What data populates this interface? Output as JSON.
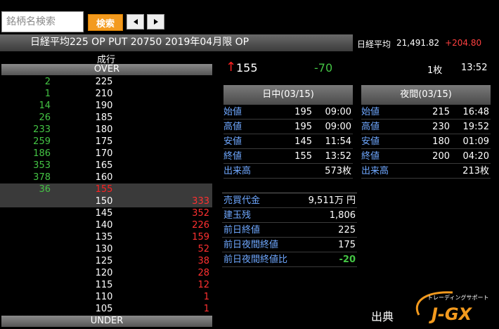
{
  "search": {
    "placeholder": "銘柄名検索",
    "button_label": "検索"
  },
  "title": "日経平均225 OP PUT 20750 2019年04月限 OP",
  "index": {
    "name": "日経平均",
    "value": "21,491.82",
    "change": "+204.80"
  },
  "board": {
    "header": "成行",
    "over_label": "OVER",
    "under_label": "UNDER",
    "rows": [
      {
        "bid": "2",
        "price": "225",
        "ask": ""
      },
      {
        "bid": "1",
        "price": "210",
        "ask": ""
      },
      {
        "bid": "14",
        "price": "190",
        "ask": ""
      },
      {
        "bid": "26",
        "price": "185",
        "ask": ""
      },
      {
        "bid": "233",
        "price": "180",
        "ask": ""
      },
      {
        "bid": "259",
        "price": "175",
        "ask": ""
      },
      {
        "bid": "186",
        "price": "170",
        "ask": ""
      },
      {
        "bid": "353",
        "price": "165",
        "ask": ""
      },
      {
        "bid": "378",
        "price": "160",
        "ask": ""
      },
      {
        "bid": "36",
        "price": "155",
        "ask": ""
      },
      {
        "bid": "",
        "price": "150",
        "ask": "333"
      },
      {
        "bid": "",
        "price": "145",
        "ask": "352"
      },
      {
        "bid": "",
        "price": "140",
        "ask": "226"
      },
      {
        "bid": "",
        "price": "135",
        "ask": "159"
      },
      {
        "bid": "",
        "price": "130",
        "ask": "52"
      },
      {
        "bid": "",
        "price": "125",
        "ask": "38"
      },
      {
        "bid": "",
        "price": "120",
        "ask": "28"
      },
      {
        "bid": "",
        "price": "115",
        "ask": "12"
      },
      {
        "bid": "",
        "price": "110",
        "ask": "1"
      },
      {
        "bid": "",
        "price": "105",
        "ask": "1"
      }
    ]
  },
  "quote": {
    "arrow": "↑",
    "last": "155",
    "change": "-70",
    "unit": "1枚",
    "time": "13:52"
  },
  "day_session": {
    "title": "日中(03/15)",
    "rows": [
      {
        "label": "始値",
        "value": "195",
        "time": "09:00"
      },
      {
        "label": "高値",
        "value": "195",
        "time": "09:00"
      },
      {
        "label": "安値",
        "value": "145",
        "time": "11:54"
      },
      {
        "label": "終値",
        "value": "155",
        "time": "13:52"
      }
    ],
    "volume_label": "出来高",
    "volume": "573枚"
  },
  "night_session": {
    "title": "夜間(03/15)",
    "rows": [
      {
        "label": "始値",
        "value": "215",
        "time": "16:48"
      },
      {
        "label": "高値",
        "value": "230",
        "time": "19:52"
      },
      {
        "label": "安値",
        "value": "180",
        "time": "01:09"
      },
      {
        "label": "終値",
        "value": "200",
        "time": "04:20"
      }
    ],
    "volume_label": "出来高",
    "volume": "213枚"
  },
  "stats": [
    {
      "label": "売買代金",
      "value": "9,511万 円"
    },
    {
      "label": "建玉残",
      "value": "1,806"
    },
    {
      "label": "前日終値",
      "value": "225"
    },
    {
      "label": "前日夜間終値",
      "value": "175"
    },
    {
      "label": "前日夜間終値比",
      "value": "-20"
    }
  ],
  "source_label": "出典",
  "logo": {
    "tagline": "トレーディングサポート",
    "text": "J-GX"
  },
  "colors": {
    "accent": "#f39a1e",
    "up": "#ff2020",
    "down": "#44c444",
    "label": "#6fa8ff"
  }
}
